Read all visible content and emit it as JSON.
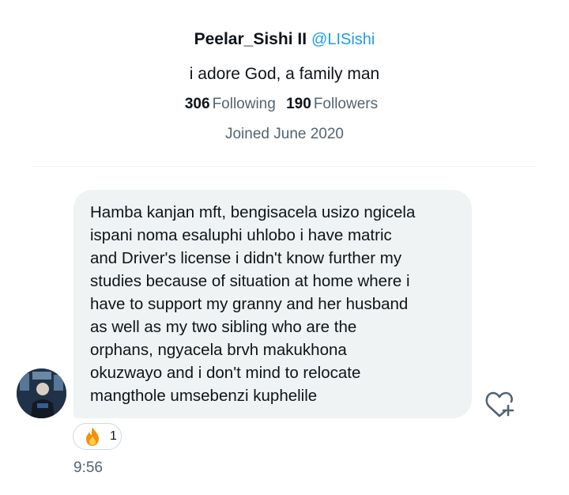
{
  "profile": {
    "display_name": "Peelar_Sishi II",
    "handle": "@LISishi",
    "bio": "i adore God, a family man",
    "following_count": "306",
    "following_label": "Following",
    "followers_count": "190",
    "followers_label": "Followers",
    "joined": "Joined June 2020"
  },
  "message": {
    "text": "Hamba kanjan mft, bengisacela usizo  ngicela\nispani noma esaluphi uhlobo i have matric\nand Driver's license i didn't know further my\nstudies because of situation at home where i\nhave to support my granny and her husband\nas well as my two sibling who are the\norphans, ngyacela brvh makukhona\nokuzwayo and i don't mind to relocate\nmangthole umsebenzi kuphelile",
    "reaction_icon": "fire-emoji",
    "reaction_count": "1",
    "timestamp": "9:56"
  },
  "colors": {
    "accent": "#1d9bf0",
    "bubble_bg": "#eff3f4",
    "secondary_text": "#536471"
  }
}
